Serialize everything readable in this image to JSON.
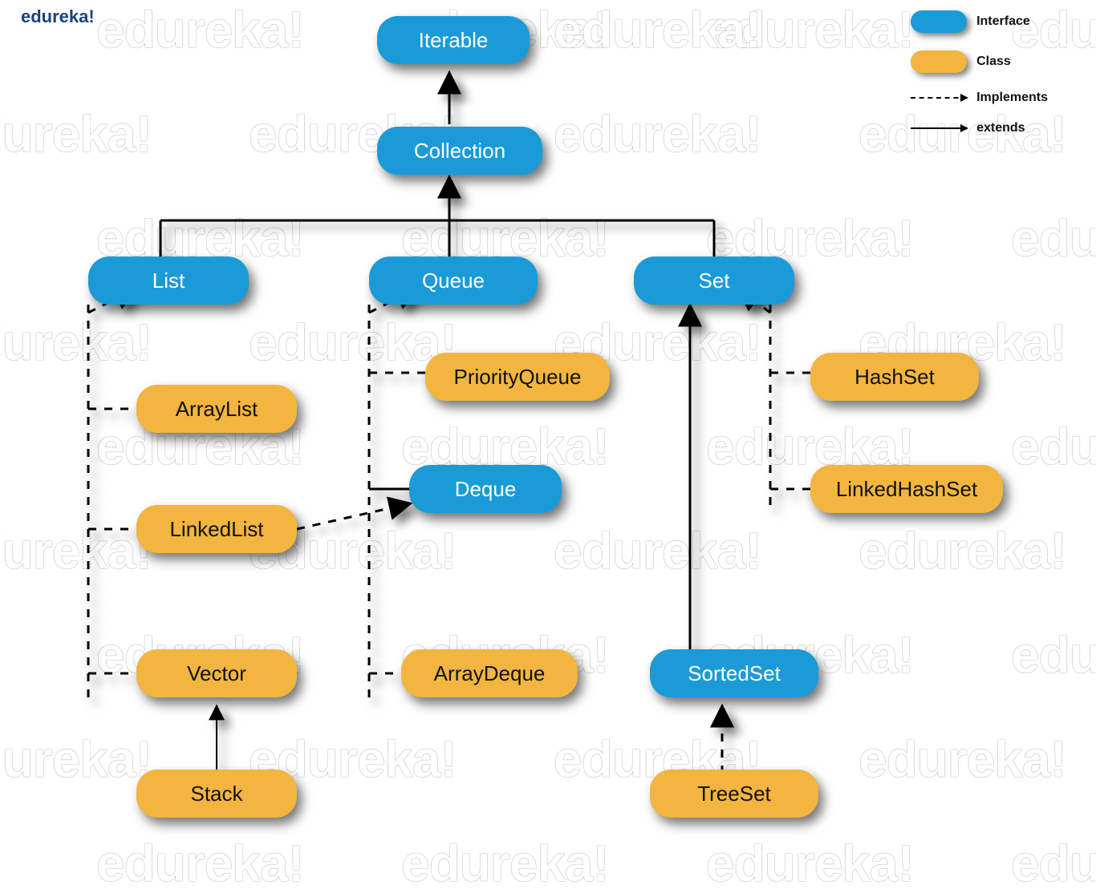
{
  "brand": "edureka!",
  "watermark_text": "edureka!",
  "legend": {
    "interface_label": "Interface",
    "class_label": "Class",
    "implements_label": "Implements",
    "extends_label": "extends"
  },
  "colors": {
    "interface": "#1a9bd7",
    "class": "#f2b53f"
  },
  "nodes": {
    "iterable": {
      "label": "Iterable",
      "type": "interface"
    },
    "collection": {
      "label": "Collection",
      "type": "interface"
    },
    "list": {
      "label": "List",
      "type": "interface"
    },
    "queue": {
      "label": "Queue",
      "type": "interface"
    },
    "set": {
      "label": "Set",
      "type": "interface"
    },
    "deque": {
      "label": "Deque",
      "type": "interface"
    },
    "sortedset": {
      "label": "SortedSet",
      "type": "interface"
    },
    "arraylist": {
      "label": "ArrayList",
      "type": "class"
    },
    "linkedlist": {
      "label": "LinkedList",
      "type": "class"
    },
    "vector": {
      "label": "Vector",
      "type": "class"
    },
    "stack": {
      "label": "Stack",
      "type": "class"
    },
    "priorityqueue": {
      "label": "PriorityQueue",
      "type": "class"
    },
    "arraydeque": {
      "label": "ArrayDeque",
      "type": "class"
    },
    "hashset": {
      "label": "HashSet",
      "type": "class"
    },
    "linkedhashset": {
      "label": "LinkedHashSet",
      "type": "class"
    },
    "treeset": {
      "label": "TreeSet",
      "type": "class"
    }
  },
  "edges": [
    {
      "from": "collection",
      "to": "iterable",
      "kind": "extends"
    },
    {
      "from": "list",
      "to": "collection",
      "kind": "extends"
    },
    {
      "from": "queue",
      "to": "collection",
      "kind": "extends"
    },
    {
      "from": "set",
      "to": "collection",
      "kind": "extends"
    },
    {
      "from": "arraylist",
      "to": "list",
      "kind": "implements"
    },
    {
      "from": "linkedlist",
      "to": "list",
      "kind": "implements"
    },
    {
      "from": "vector",
      "to": "list",
      "kind": "implements"
    },
    {
      "from": "stack",
      "to": "vector",
      "kind": "extends"
    },
    {
      "from": "priorityqueue",
      "to": "queue",
      "kind": "implements"
    },
    {
      "from": "deque",
      "to": "queue",
      "kind": "extends"
    },
    {
      "from": "linkedlist",
      "to": "deque",
      "kind": "implements"
    },
    {
      "from": "arraydeque",
      "to": "deque",
      "kind": "implements"
    },
    {
      "from": "hashset",
      "to": "set",
      "kind": "implements"
    },
    {
      "from": "linkedhashset",
      "to": "set",
      "kind": "implements"
    },
    {
      "from": "sortedset",
      "to": "set",
      "kind": "extends"
    },
    {
      "from": "treeset",
      "to": "sortedset",
      "kind": "implements"
    }
  ]
}
